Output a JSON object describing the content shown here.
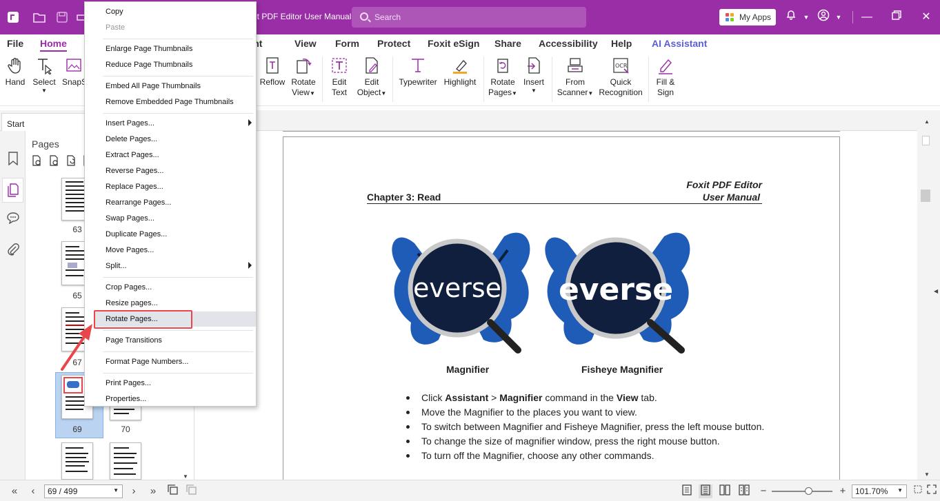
{
  "window": {
    "title": "it PDF Editor User Manual",
    "search_placeholder": "Search",
    "my_apps": "My Apps"
  },
  "menu": {
    "tabs": [
      "File",
      "Home",
      "ment",
      "View",
      "Form",
      "Protect",
      "Foxit eSign",
      "Share",
      "Accessibility",
      "Help",
      "AI Assistant"
    ],
    "active": "Home"
  },
  "ribbon": {
    "hand": "Hand",
    "select": "Select",
    "snapshot": "SnapS",
    "reflow": "Reflow",
    "rotate_view": [
      "Rotate",
      "View"
    ],
    "edit_text": [
      "Edit",
      "Text"
    ],
    "edit_object": [
      "Edit",
      "Object"
    ],
    "typewriter": "Typewriter",
    "highlight": "Highlight",
    "rotate_pages": [
      "Rotate",
      "Pages"
    ],
    "insert": "Insert",
    "from_scanner": [
      "From",
      "Scanner"
    ],
    "quick_recognition": [
      "Quick",
      "Recognition"
    ],
    "fill_sign": [
      "Fill &",
      "Sign"
    ]
  },
  "tabs": {
    "start": "Start"
  },
  "pages_panel": {
    "label": "Pages",
    "thumbnails": [
      "63",
      "65",
      "67",
      "69",
      "70"
    ]
  },
  "context_menu": {
    "copy": "Copy",
    "paste": "Paste",
    "enlarge": "Enlarge Page Thumbnails",
    "reduce": "Reduce Page Thumbnails",
    "embed": "Embed All Page Thumbnails",
    "remove_embedded": "Remove Embedded Page Thumbnails",
    "insert_pages": "Insert Pages...",
    "delete_pages": "Delete Pages...",
    "extract_pages": "Extract Pages...",
    "reverse_pages": "Reverse Pages...",
    "replace_pages": "Replace Pages...",
    "rearrange_pages": "Rearrange Pages...",
    "swap_pages": "Swap Pages...",
    "duplicate_pages": "Duplicate Pages...",
    "move_pages": "Move Pages...",
    "split": "Split...",
    "crop_pages": "Crop Pages...",
    "resize_pages": "Resize pages...",
    "rotate_pages": "Rotate Pages...",
    "page_transitions": "Page Transitions",
    "format_page_numbers": "Format Page Numbers...",
    "print_pages": "Print Pages...",
    "properties": "Properties..."
  },
  "document": {
    "header_right_1": "Foxit  PDF  Editor",
    "header_right_2": "User Manual",
    "chapter": "Chapter 3: Read",
    "image_lens_text": "everse",
    "caption_left": "Magnifier",
    "caption_right": "Fisheye Magnifier",
    "bullets": [
      {
        "parts": [
          [
            "Click ",
            false
          ],
          [
            "Assistant",
            true
          ],
          [
            " > ",
            false
          ],
          [
            "Magnifier",
            true
          ],
          [
            " command in the ",
            false
          ],
          [
            "View",
            true
          ],
          [
            " tab.",
            false
          ]
        ]
      },
      {
        "parts": [
          [
            "Move the Magnifier to the places you want to view.",
            false
          ]
        ]
      },
      {
        "parts": [
          [
            "To switch between Magnifier and Fisheye Magnifier, press the left mouse button.",
            false
          ]
        ]
      },
      {
        "parts": [
          [
            "To change the size of magnifier window, press the right mouse button.",
            false
          ]
        ]
      },
      {
        "parts": [
          [
            "To turn off the Magnifier, choose any other commands.",
            false
          ]
        ]
      }
    ]
  },
  "status": {
    "page_field": "69 / 499",
    "zoom_field": "101.70%",
    "zoom_level": 0.6
  },
  "colors": {
    "brand": "#9a2ea6",
    "active_tab": "#9b2ca7",
    "ai_tab": "#5a5ed8",
    "highlight_box": "#e8464b",
    "selected_thumb": "#b9d3f1"
  }
}
